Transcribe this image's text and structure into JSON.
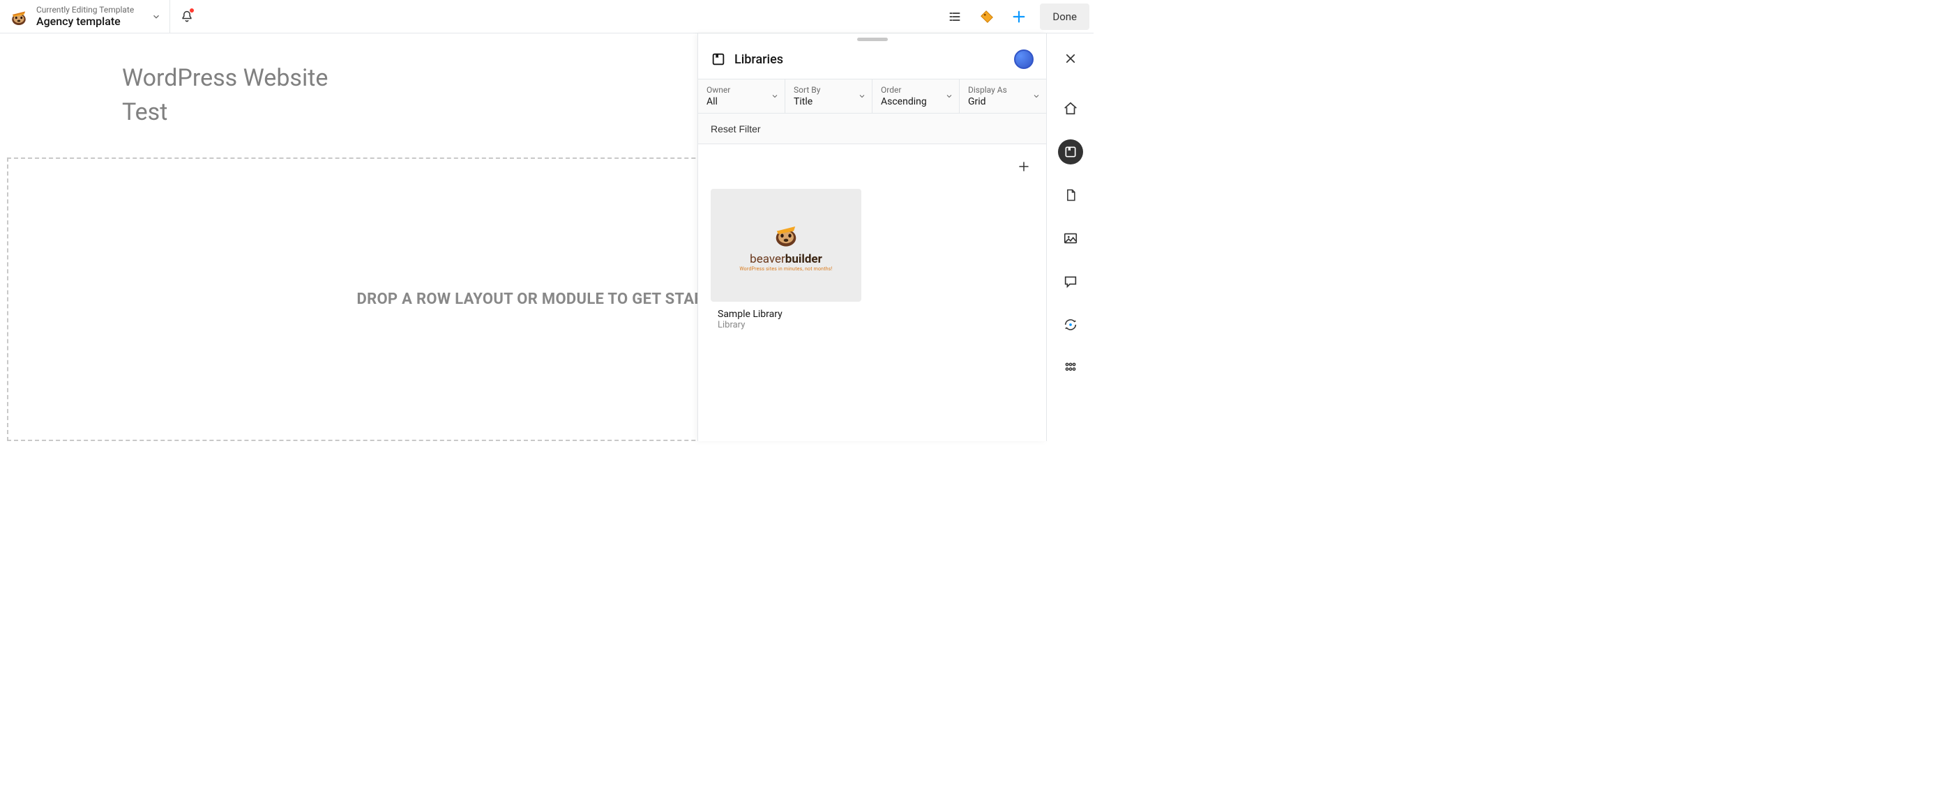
{
  "header": {
    "subtitle": "Currently Editing Template",
    "title": "Agency template",
    "done_label": "Done"
  },
  "page": {
    "title_line1": "WordPress Website",
    "title_line2": "Test",
    "drop_text": "DROP A ROW LAYOUT OR MODULE TO GET STARTED!"
  },
  "panel": {
    "title": "Libraries",
    "filters": {
      "owner": {
        "label": "Owner",
        "value": "All"
      },
      "sort": {
        "label": "Sort By",
        "value": "Title"
      },
      "order": {
        "label": "Order",
        "value": "Ascending"
      },
      "display": {
        "label": "Display As",
        "value": "Grid"
      }
    },
    "reset_label": "Reset Filter",
    "library": {
      "logo_text_1": "beaver",
      "logo_text_2": "builder",
      "logo_tag": "WordPress sites in minutes, not months!",
      "title": "Sample Library",
      "subtitle": "Library"
    }
  }
}
